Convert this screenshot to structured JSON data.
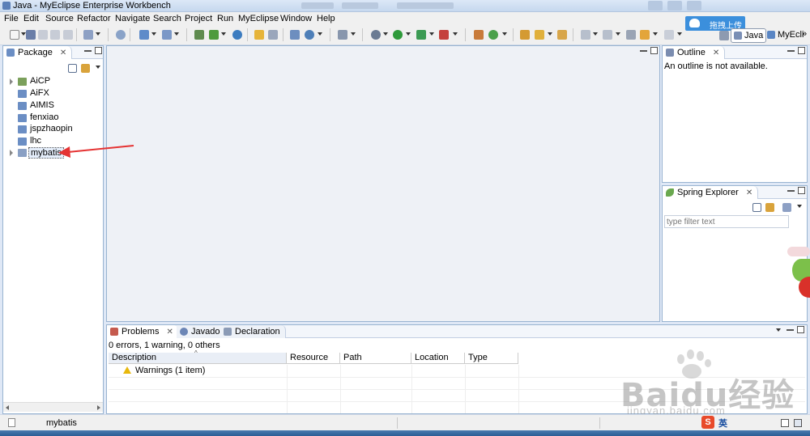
{
  "window": {
    "title": "Java - MyEclipse Enterprise Workbench"
  },
  "menu": [
    "File",
    "Edit",
    "Source",
    "Refactor",
    "Navigate",
    "Search",
    "Project",
    "Run",
    "MyEclipse",
    "Window",
    "Help"
  ],
  "upload_widget": {
    "label": "拖拽上传"
  },
  "perspectives": [
    {
      "label": "Java",
      "active": true
    },
    {
      "label": "MyEcli",
      "active": false
    }
  ],
  "perspective_more": "»",
  "package_explorer": {
    "tab_label": "Package",
    "close_glyph": "✕",
    "items": [
      {
        "label": "AiCP",
        "expandable": true,
        "selected": false,
        "icon": "project-icon"
      },
      {
        "label": "AiFX",
        "expandable": false,
        "selected": false,
        "icon": "folder-icon"
      },
      {
        "label": "AIMIS",
        "expandable": false,
        "selected": false,
        "icon": "folder-icon"
      },
      {
        "label": "fenxiao",
        "expandable": false,
        "selected": false,
        "icon": "folder-icon"
      },
      {
        "label": "jspzhaopin",
        "expandable": false,
        "selected": false,
        "icon": "folder-icon"
      },
      {
        "label": "lhc",
        "expandable": false,
        "selected": false,
        "icon": "folder-icon"
      },
      {
        "label": "mybatis",
        "expandable": true,
        "selected": true,
        "icon": "project-icon"
      }
    ]
  },
  "outline": {
    "tab_label": "Outline",
    "message": "An outline is not available."
  },
  "spring_explorer": {
    "tab_label": "Spring Explorer",
    "filter_placeholder": "type filter text"
  },
  "bottom_tabs": [
    {
      "label": "Problems",
      "active": true
    },
    {
      "label": "Javadoc",
      "active": false
    },
    {
      "label": "Declaration",
      "active": false
    }
  ],
  "problems": {
    "summary": "0 errors, 1 warning, 0 others",
    "columns": [
      "Description",
      "Resource",
      "Path",
      "Location",
      "Type"
    ],
    "rows": [
      {
        "description": "Warnings (1 item)",
        "severity": "warning"
      }
    ]
  },
  "status_bar": {
    "selected": "mybatis"
  },
  "ime": {
    "logo": "S",
    "label": "英"
  },
  "watermark": {
    "brand": "Baidu经验",
    "url": "jingyan.baidu.com"
  },
  "colors": {
    "accent": "#3b8fdc",
    "selection_arrow": "#e53333",
    "warning": "#e8b80c",
    "pane_border": "#99b4d1"
  }
}
